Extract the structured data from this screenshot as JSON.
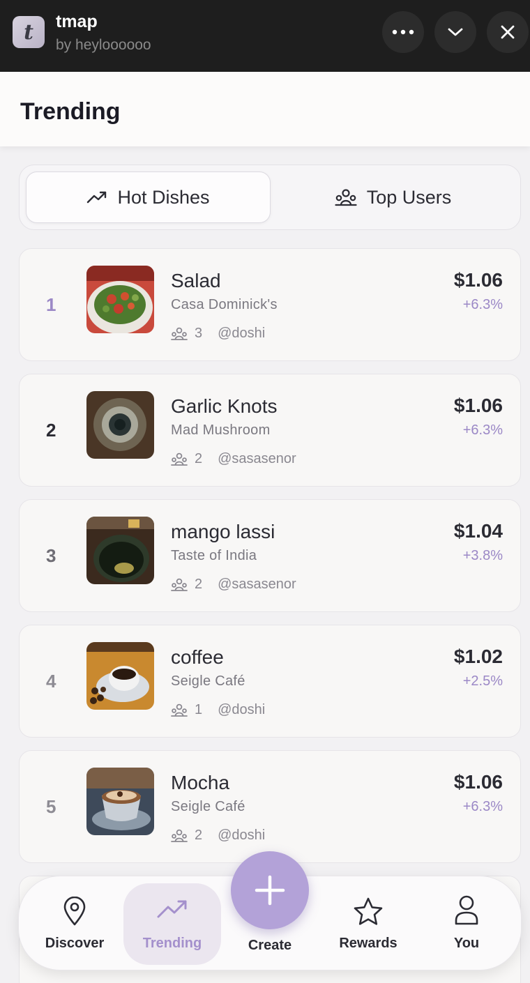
{
  "app": {
    "icon_letter": "t",
    "name": "tmap",
    "author": "by heyloooooo"
  },
  "window_controls": {
    "more_icon": "more-horizontal-icon",
    "collapse_icon": "chevron-down-icon",
    "close_icon": "close-icon"
  },
  "header": {
    "title": "Trending"
  },
  "tabs": {
    "hot_dishes": {
      "label": "Hot Dishes",
      "icon": "trending-up-icon",
      "active": true
    },
    "top_users": {
      "label": "Top Users",
      "icon": "users-icon",
      "active": false
    }
  },
  "dishes": [
    {
      "rank": "1",
      "name": "Salad",
      "restaurant": "Casa Dominick's",
      "count": "3",
      "user": "@doshi",
      "price": "$1.06",
      "change": "+6.3%",
      "rank_color": "#9b88c6"
    },
    {
      "rank": "2",
      "name": "Garlic Knots",
      "restaurant": "Mad Mushroom",
      "count": "2",
      "user": "@sasasenor",
      "price": "$1.06",
      "change": "+6.3%",
      "rank_color": "#2b2b33"
    },
    {
      "rank": "3",
      "name": "mango lassi",
      "restaurant": "Taste of India",
      "count": "2",
      "user": "@sasasenor",
      "price": "$1.04",
      "change": "+3.8%",
      "rank_color": "#6f6d75"
    },
    {
      "rank": "4",
      "name": "coffee",
      "restaurant": "Seigle Café",
      "count": "1",
      "user": "@doshi",
      "price": "$1.02",
      "change": "+2.5%",
      "rank_color": "#8e8c94"
    },
    {
      "rank": "5",
      "name": "Mocha",
      "restaurant": "Seigle Café",
      "count": "2",
      "user": "@doshi",
      "price": "$1.06",
      "change": "+6.3%",
      "rank_color": "#8e8c94"
    }
  ],
  "nav": {
    "discover": {
      "label": "Discover",
      "icon": "map-pin-icon"
    },
    "trending": {
      "label": "Trending",
      "icon": "trending-up-icon",
      "active": true
    },
    "create": {
      "label": "Create",
      "icon": "plus-icon"
    },
    "rewards": {
      "label": "Rewards",
      "icon": "star-icon"
    },
    "you": {
      "label": "You",
      "icon": "user-icon"
    }
  },
  "colors": {
    "accent": "#a490cc",
    "topbar": "#1e1e1e",
    "create_button": "#b3a2d8"
  }
}
